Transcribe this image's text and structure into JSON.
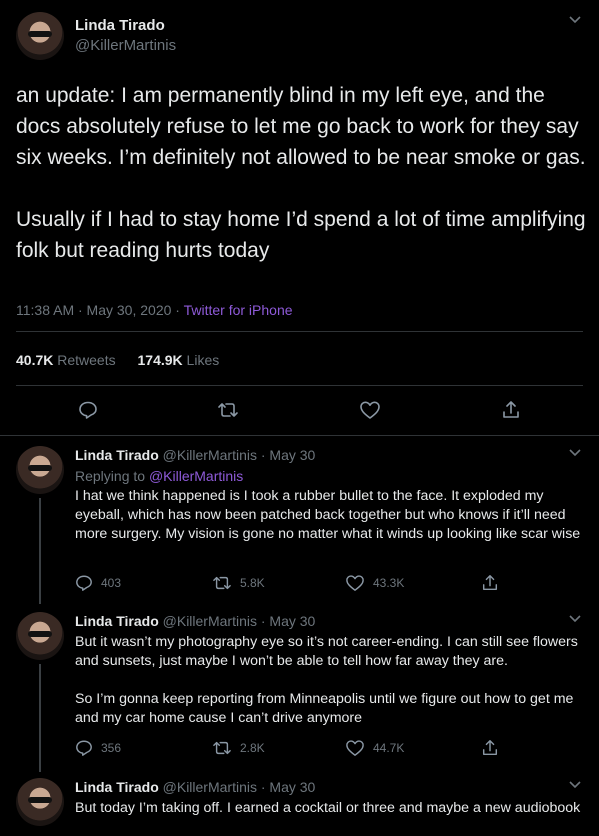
{
  "main_tweet": {
    "name": "Linda Tirado",
    "handle": "@KillerMartinis",
    "paragraphs": [
      "an update: I am permanently blind in my left eye, and the docs absolutely refuse to let me go back to work for they say six weeks. I’m definitely not allowed to be near smoke or gas.",
      "Usually if I had to stay home I’d spend a lot of time amplifying folk but reading hurts today"
    ],
    "timestamp": "11:38 AM · May 30, 2020 · ",
    "source": "Twitter for iPhone",
    "retweets_count": "40.7K",
    "retweets_label": "Retweets",
    "likes_count": "174.9K",
    "likes_label": "Likes"
  },
  "replies": [
    {
      "name": "Linda Tirado",
      "handle_date": "@KillerMartinis · May 30",
      "replying_prefix": "Replying to ",
      "replying_handle": "@KillerMartinis",
      "paragraphs": [
        "I hat we think happened is I took a rubber bullet to the face. It exploded my eyeball, which has now been patched back together but who knows if it’ll need more surgery. My vision is gone no matter what it winds up looking like scar wise"
      ],
      "reply_count": "403",
      "retweet_count": "5.8K",
      "like_count": "43.3K"
    },
    {
      "name": "Linda Tirado",
      "handle_date": "@KillerMartinis · May 30",
      "paragraphs": [
        "But it wasn’t my photography eye so it’s not career-ending. I can still see flowers and sunsets, just maybe I won’t be able to tell how far away they are.",
        "So I’m gonna keep reporting from Minneapolis until we figure out how to get me and my car home cause I can’t drive anymore"
      ],
      "reply_count": "356",
      "retweet_count": "2.8K",
      "like_count": "44.7K"
    },
    {
      "name": "Linda Tirado",
      "handle_date": "@KillerMartinis · May 30",
      "paragraphs": [
        "But today I’m taking off. I earned a cocktail or three and maybe a new audiobook"
      ]
    }
  ],
  "icons": {
    "chevron": "chevron-down-icon",
    "reply": "reply-icon",
    "retweet": "retweet-icon",
    "like": "heart-icon",
    "share": "share-icon"
  },
  "colors": {
    "background": "#000000",
    "text": "#e7e9ea",
    "muted": "#6e767d",
    "link": "#8e5ad8",
    "divider": "#2f3336"
  }
}
